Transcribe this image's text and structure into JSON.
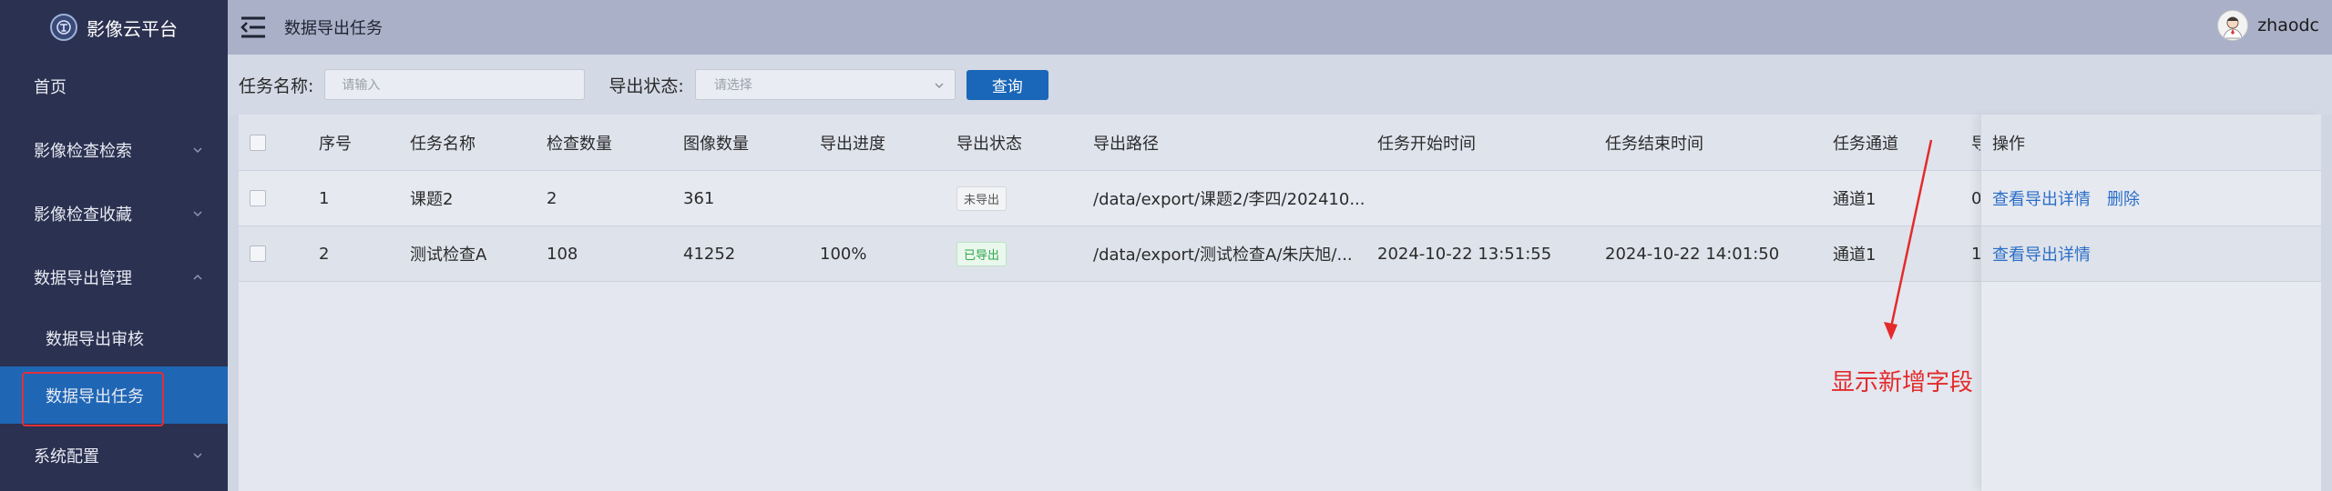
{
  "app": {
    "brand": "影像云平台"
  },
  "sidebar": {
    "items": [
      {
        "label": "首页"
      },
      {
        "label": "影像检查检索"
      },
      {
        "label": "影像检查收藏"
      },
      {
        "label": "数据导出管理"
      }
    ],
    "sub_items": [
      {
        "label": "数据导出审核"
      },
      {
        "label": "数据导出任务"
      }
    ],
    "bottom_item": {
      "label": "系统配置"
    }
  },
  "header": {
    "title": "数据导出任务",
    "username": "zhaodc"
  },
  "filters": {
    "task_name_label": "任务名称:",
    "task_name_placeholder": "请输入",
    "status_label": "导出状态:",
    "status_placeholder": "请选择",
    "query_button": "查询"
  },
  "table": {
    "columns": [
      "序号",
      "任务名称",
      "检查数量",
      "图像数量",
      "导出进度",
      "导出状态",
      "导出路径",
      "任务开始时间",
      "任务结束时间",
      "任务通道",
      "导",
      "操作"
    ],
    "rows": [
      {
        "index": "1",
        "name": "课题2",
        "exam_count": "2",
        "image_count": "361",
        "progress": "",
        "status": "未导出",
        "path": "/data/export/课题2/李四/202410...",
        "start": "",
        "end": "",
        "channel": "通道1",
        "extra": "0",
        "actions": [
          "查看导出详情",
          "删除"
        ]
      },
      {
        "index": "2",
        "name": "测试检查A",
        "exam_count": "108",
        "image_count": "41252",
        "progress": "100%",
        "status": "已导出",
        "path": "/data/export/测试检查A/朱庆旭/...",
        "start": "2024-10-22 13:51:55",
        "end": "2024-10-22 14:01:50",
        "channel": "通道1",
        "extra": "1",
        "actions": [
          "查看导出详情"
        ]
      }
    ]
  },
  "annotation": {
    "text": "显示新增字段",
    "color": "#e32b2b"
  },
  "colors": {
    "sidebar_bg": "#2b3150",
    "active_bg": "#1f66b5",
    "header_bg": "#a9b0c8",
    "primary": "#1a66b8"
  }
}
